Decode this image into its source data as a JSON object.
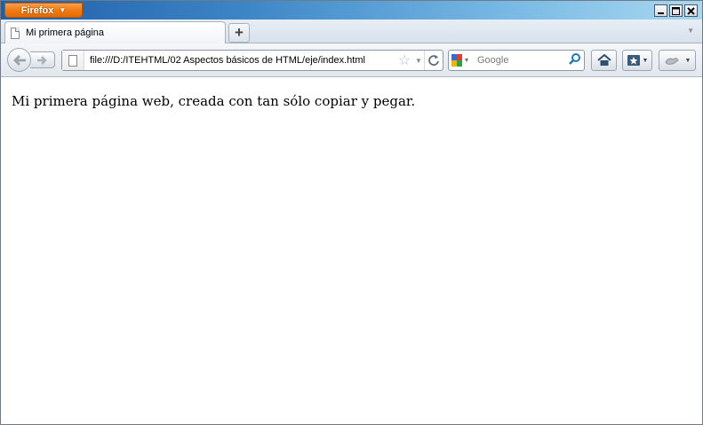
{
  "window": {
    "app_button_label": "Firefox",
    "controls": {
      "minimize": "▁",
      "maximize": "□",
      "close": "✕"
    }
  },
  "tabs": [
    {
      "title": "Mi primera página",
      "icon": "page-icon",
      "active": true
    }
  ],
  "new_tab_symbol": "+",
  "navigation": {
    "url": "file:///D:/ITEHTML/02 Aspectos básicos de HTML/eje/index.html",
    "search_placeholder": "Google",
    "search_engine_icon": "google-icon",
    "buttons": [
      "back-icon",
      "forward-icon",
      "bookmark-star-icon",
      "reload-icon",
      "home-icon",
      "bookmarks-menu-icon",
      "addon-icon"
    ]
  },
  "page": {
    "body_text": "Mi primera página web, creada con tan sólo copiar y pegar."
  },
  "colors": {
    "firefox_button": "#f17c12",
    "titlebar_start": "#1f5ea8",
    "titlebar_end": "#a9d8f1",
    "content_bg": "#ffffff"
  }
}
